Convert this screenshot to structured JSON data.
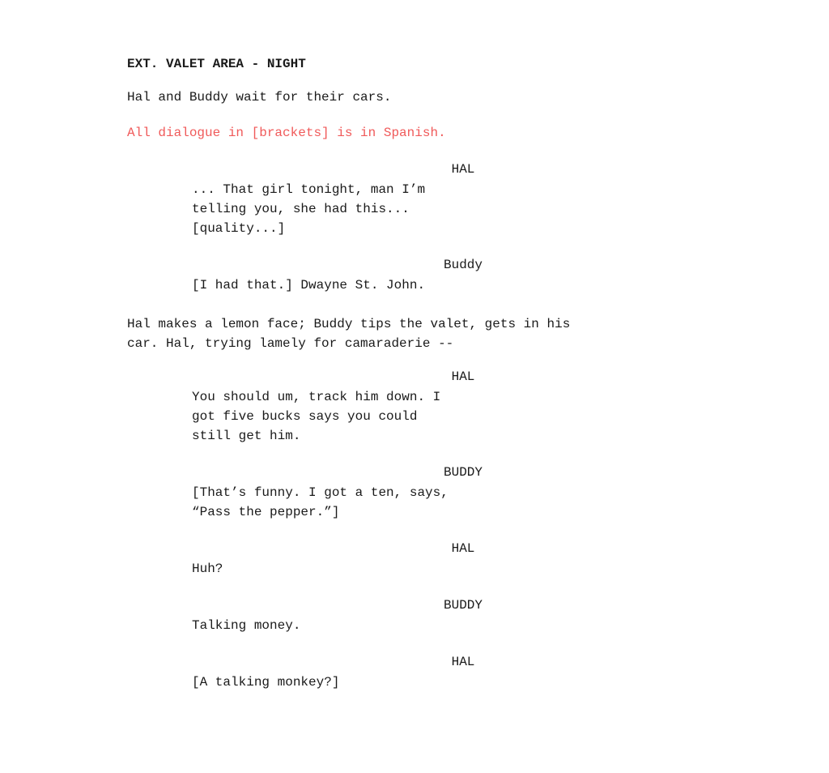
{
  "screenplay": {
    "scene_heading": "EXT. VALET AREA - NIGHT",
    "action_1": "Hal and Buddy wait for their cars.",
    "note": "All dialogue in [brackets] is in Spanish.",
    "dialogue_blocks": [
      {
        "id": "hal-1",
        "character": "HAL",
        "character_case": "uppercase",
        "lines": "... That girl tonight, man I’m\ntelling you, she had this...\n[quality...]"
      },
      {
        "id": "buddy-1",
        "character": "Buddy",
        "character_case": "normal",
        "lines": "[I had that.] Dwayne St. John."
      }
    ],
    "action_2": "Hal makes a lemon face; Buddy tips the valet, gets in his\ncar. Hal, trying lamely for camaraderie --",
    "dialogue_blocks_2": [
      {
        "id": "hal-2",
        "character": "HAL",
        "character_case": "uppercase",
        "lines": "You should um, track him down. I\ngot five bucks says you could\nstill get him."
      },
      {
        "id": "buddy-2",
        "character": "BUDDY",
        "character_case": "uppercase",
        "lines": "[That’s funny. I got a ten, says,\n“Pass the pepper.”]"
      },
      {
        "id": "hal-3",
        "character": "HAL",
        "character_case": "uppercase",
        "lines": "Huh?"
      },
      {
        "id": "buddy-3",
        "character": "BUDDY",
        "character_case": "uppercase",
        "lines": "Talking money."
      },
      {
        "id": "hal-4",
        "character": "HAL",
        "character_case": "uppercase",
        "lines": "[A talking monkey?]"
      }
    ]
  }
}
